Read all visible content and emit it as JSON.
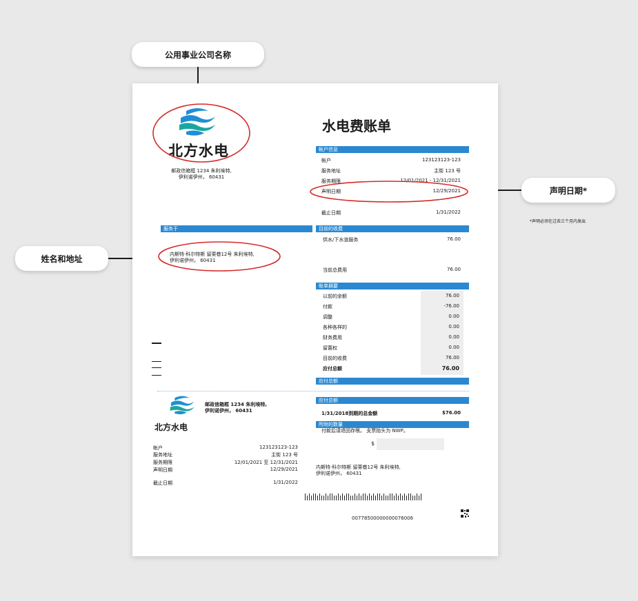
{
  "callouts": {
    "utility_name": "公用事业公司名称",
    "name_address": "姓名和地址",
    "statement_date": "声明日期*",
    "statement_note": "*声明必须在过去三个月内发出"
  },
  "bill": {
    "company_name": "北方水电",
    "company_address": "邮政信箱框 1234 朱利埃特,\n伊利诺伊州， 60431",
    "title": "水电费账单",
    "account_info": {
      "header": "帐户信息",
      "rows": [
        {
          "label": "帐户",
          "value": "123123123-123"
        },
        {
          "label": "服务地址",
          "value": "主街 123 号"
        },
        {
          "label": "服务期限",
          "value": "12/01/2021 - 12/31/2021"
        },
        {
          "label": "声明日期",
          "value": "12/29/2021"
        }
      ],
      "due_label": "截止日期",
      "due_value": "1/31/2022"
    },
    "served": {
      "header": "服务于",
      "address": "内斯特·科尔特斯 留栗巷12号 朱利埃特,\n伊利诺伊州， 60431"
    },
    "current_charges": {
      "header": "目前的收费",
      "service_label": "供水/下水道服务",
      "service_value": "76.00",
      "total_label": "当前总费用",
      "total_value": "76.00"
    },
    "summary": {
      "header": "账单摘要",
      "rows": [
        {
          "label": "以前的余额",
          "value": "76.00"
        },
        {
          "label": "付款",
          "value": "-76.00"
        },
        {
          "label": "调整",
          "value": "0.00"
        },
        {
          "label": "各种各样的",
          "value": "0.00"
        },
        {
          "label": "财务费用",
          "value": "0.00"
        },
        {
          "label": "留置权",
          "value": "0.00"
        },
        {
          "label": "目前的收费",
          "value": "76.00"
        }
      ],
      "total_label": "应付总额",
      "total_value": "76.00"
    },
    "total_due_header": "应付总额",
    "stub": {
      "company_address": "邮政信箱框 1234 朱利埃特,\n伊利诺伊州， 60431",
      "company_name": "北方水电",
      "rows": [
        {
          "label": "帐户",
          "value": "123123123-123"
        },
        {
          "label": "服务地址",
          "value": "主街 123 号"
        },
        {
          "label": "服务期限",
          "value": "12/01/2021 至 12/31/2021"
        },
        {
          "label": "声明日期",
          "value": "12/29/2021"
        }
      ],
      "due_label": "截止日期",
      "due_value": "1/31/2022",
      "total_header": "应付总额",
      "total_line_label": "1/31/2018到期的总金额",
      "total_line_value": "$76.00",
      "enclosed_header": "所附的数量",
      "enclosed_note": "付款后请退回存根。 支票抬头为 NWP。",
      "dollar": "$",
      "address": "内斯特·科尔特斯 留栗巷12号 朱利埃特,\n伊利诺伊州， 60431",
      "barcode_number": "00778500000000076006"
    }
  }
}
